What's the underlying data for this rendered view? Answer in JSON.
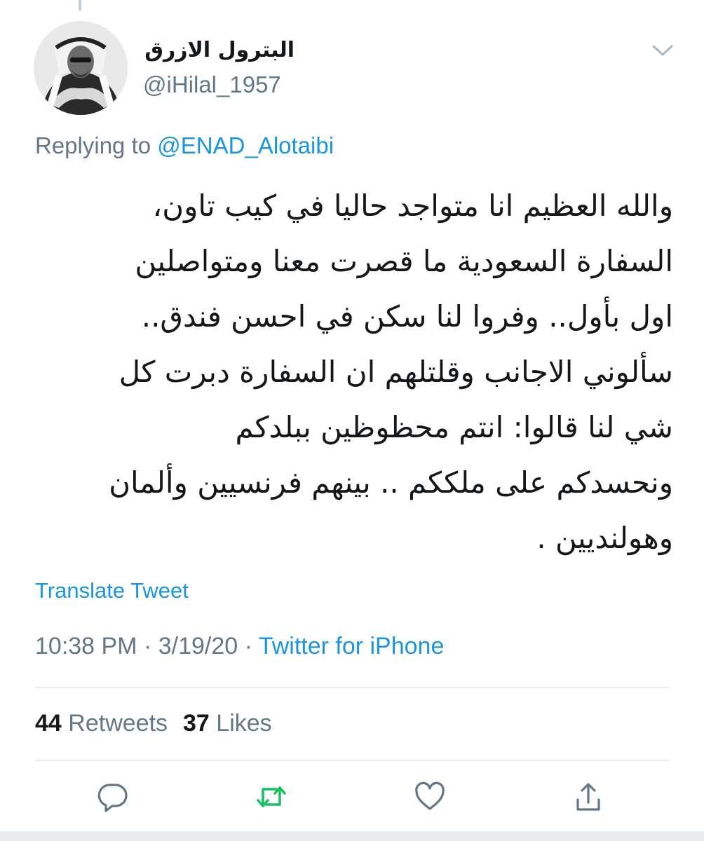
{
  "author": {
    "display_name": "البترول الازرق",
    "handle": "@iHilal_1957",
    "avatar_icon": "profile-photo"
  },
  "reply": {
    "prefix": "Replying to",
    "mention": "@ENAD_Alotaibi"
  },
  "tweet": {
    "text": "والله العظيم انا متواجد حاليا في كيب تاون،\nالسفارة السعودية ما قصرت معنا ومتواصلين\nاول بأول.. وفروا لنا سكن في احسن فندق..\nسألوني الاجانب وقلتلهم ان السفارة دبرت كل\nشي لنا قالوا: انتم محظوظين ببلدكم\nونحسدكم على ملككم .. بينهم فرنسيين وألمان\nوهولنديين ."
  },
  "translate_label": "Translate Tweet",
  "meta": {
    "time": "10:38 PM",
    "date": "3/19/20",
    "separator": " · ",
    "source": "Twitter for iPhone"
  },
  "stats": {
    "retweets_count": "44",
    "retweets_label": "Retweets",
    "likes_count": "37",
    "likes_label": "Likes"
  },
  "actions": {
    "reply_icon": "comment-icon",
    "retweet_icon": "retweet-icon",
    "like_icon": "heart-icon",
    "share_icon": "share-icon"
  },
  "colors": {
    "link": "#1b95e0",
    "secondary_text": "#657786",
    "primary_text": "#14171a",
    "retweet_green": "#17bf63",
    "divider": "#e6ecf0"
  }
}
